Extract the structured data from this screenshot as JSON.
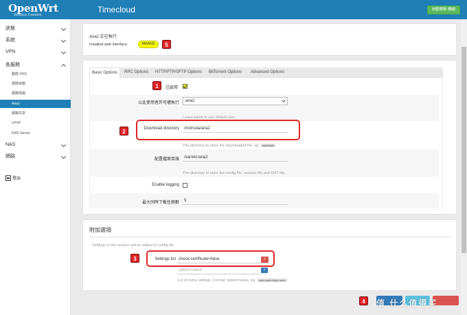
{
  "header": {
    "logo": "OpenWrt",
    "logo_tagline": "Wireless Freedom",
    "hostname": "Timecloud",
    "refresh_label": "自動更新 開啟"
  },
  "sidebar": {
    "items": [
      {
        "label": "狀態",
        "expanded": false
      },
      {
        "label": "系統",
        "expanded": false
      },
      {
        "label": "VPN",
        "expanded": false
      },
      {
        "label": "各服務",
        "expanded": true
      },
      {
        "label": "NAS",
        "expanded": false
      },
      {
        "label": "網路",
        "expanded": false
      }
    ],
    "sub_items": [
      {
        "label": "動態 DNS",
        "active": false
      },
      {
        "label": "硬碟休眠",
        "active": false
      },
      {
        "label": "網路喚醒",
        "active": false
      },
      {
        "label": "Aria2",
        "active": true
      },
      {
        "label": "網路共享",
        "active": false
      },
      {
        "label": "UPnP",
        "active": false
      },
      {
        "label": "KMS Server",
        "active": false
      }
    ],
    "logout": "登出"
  },
  "status": {
    "running": "Aria2 正在執行",
    "web_interface_label": "Installed web interface:",
    "ariang_button": "ARIANG"
  },
  "tabs": [
    {
      "label": "Basic Options",
      "active": true
    },
    {
      "label": "RPC Options",
      "active": false
    },
    {
      "label": "HTTP/FTP/SFTP Options",
      "active": false
    },
    {
      "label": "BitTorrent Options",
      "active": false
    },
    {
      "label": "Advanced Options",
      "active": false
    }
  ],
  "form": {
    "enabled_label": "已啟用",
    "enabled_checked": true,
    "run_user_label": "以此使用者許可權執行",
    "run_user_value": "aria2",
    "run_user_hint": "Leave blank to use default user.",
    "download_dir_label": "Download directory",
    "download_dir_value": "/mnt/sda/aria2",
    "download_dir_hint": "The directory to store the downloaded file. eg.",
    "download_dir_hint_code": "/mnt/sda1",
    "config_dir_label": "配置檔案目錄",
    "config_dir_value": "/var/etc/aria2",
    "config_dir_hint": "The directory to store the config file, session file and DHT file.",
    "enable_logging_label": "Enable logging",
    "enable_logging_checked": false,
    "max_downloads_label": "最大同時下載任務數",
    "max_downloads_value": "5"
  },
  "extra": {
    "title": "附加選項",
    "description": "Settings in this section will be added to config file.",
    "settings_list_label": "Settings list",
    "settings_list_value": "check-certificate=false",
    "new_entry_placeholder": "option=value",
    "hint": "List of extra settings. Format: option=value, eg.",
    "hint_code": "netrc-path=/tmp/.netrc"
  },
  "markers": [
    "1",
    "2",
    "3",
    "4",
    "5"
  ],
  "watermark": "值 什么值得买",
  "colors": {
    "header": "#1f7fb6",
    "active_nav": "#1f7fb6",
    "marker": "#e02424",
    "ariang_highlight": "#f5f800",
    "remove_button": "#d9534f"
  }
}
